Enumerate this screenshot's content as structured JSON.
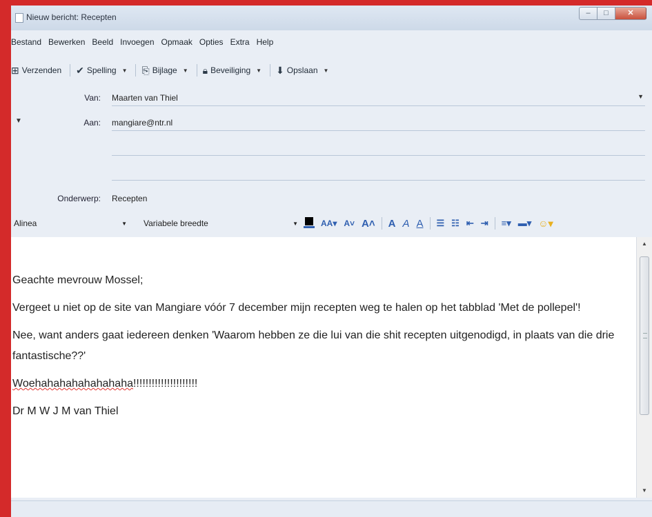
{
  "window": {
    "title": "Nieuw bericht: Recepten",
    "controls": {
      "minimize": "–",
      "maximize": "□",
      "close": "✕"
    }
  },
  "menu": [
    "Bestand",
    "Bewerken",
    "Beeld",
    "Invoegen",
    "Opmaak",
    "Opties",
    "Extra",
    "Help"
  ],
  "toolbar": {
    "send": "Verzenden",
    "spelling": "Spelling",
    "attachment": "Bijlage",
    "security": "Beveiliging",
    "save": "Opslaan"
  },
  "fields": {
    "van_label": "Van:",
    "van_value": "Maarten van Thiel",
    "aan_label": "Aan:",
    "aan_value": "mangiare@ntr.nl",
    "subject_label": "Onderwerp:",
    "subject_value": "Recepten"
  },
  "format": {
    "paragraph": "Alinea",
    "font": "Variabele breedte"
  },
  "message": {
    "greeting": "Geachte mevrouw Mossel;",
    "para1": "Vergeet u niet op de site van Mangiare vóór 7 december mijn recepten weg te halen op het tabblad 'Met de pollepel'!",
    "para2": "Nee, want anders gaat iedereen denken 'Waarom hebben ze die lui van die shit recepten uitgenodigd, in plaats van die drie fantastische??'",
    "laugh_word": "Woehahahahahahahaha",
    "laugh_excl": "!!!!!!!!!!!!!!!!!!!!!",
    "signature": "Dr M W J M van Thiel"
  }
}
